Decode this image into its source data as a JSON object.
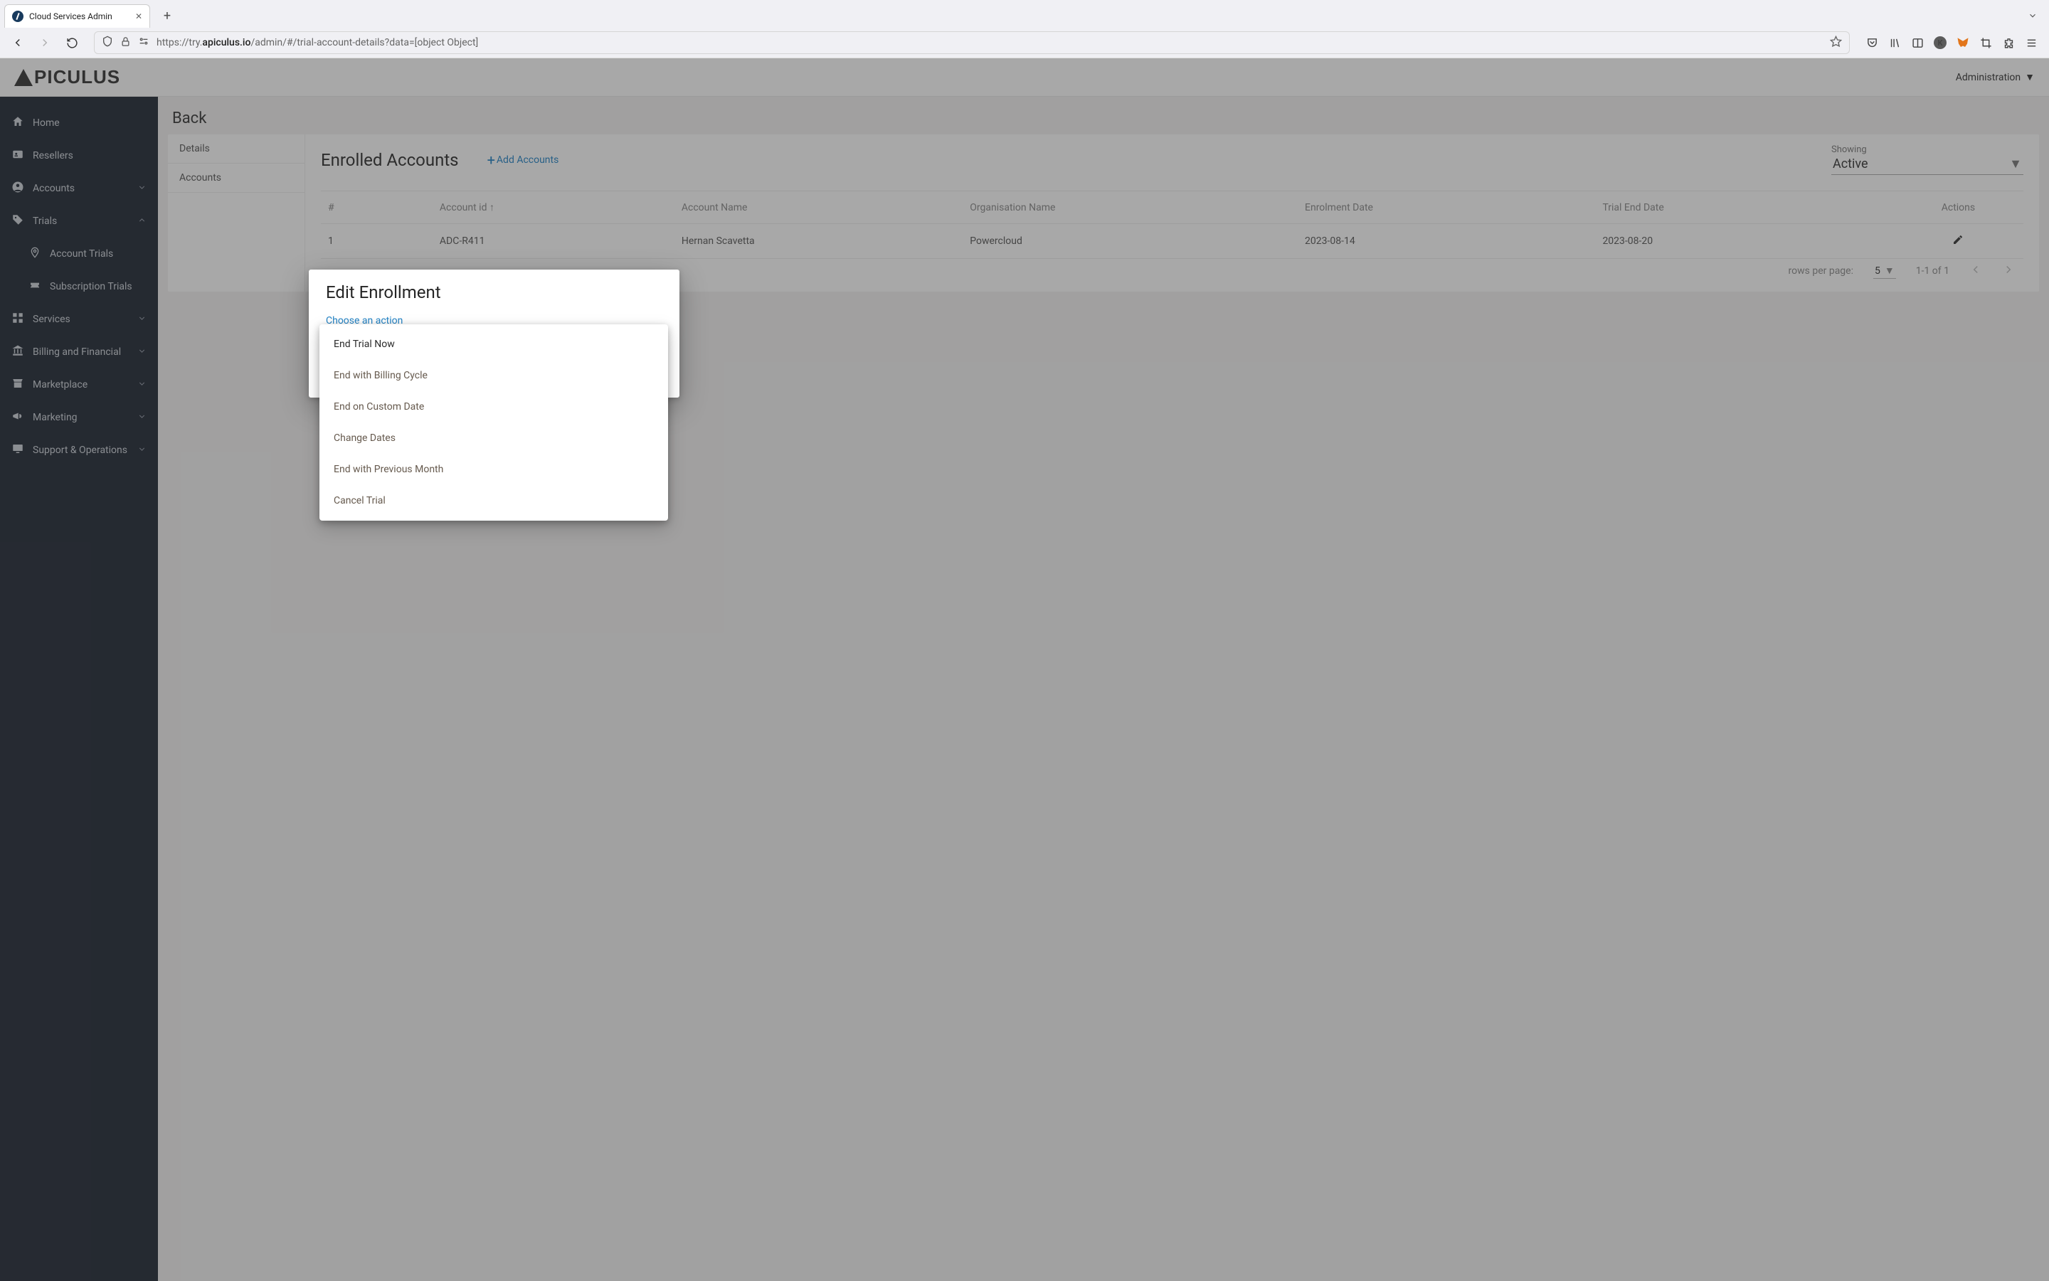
{
  "browser": {
    "tab_title": "Cloud Services Admin",
    "url_prefix": "https://try.",
    "url_bold": "apiculus.io",
    "url_suffix": "/admin/#/trial-account-details?data=[object Object]"
  },
  "header": {
    "logo_text": "PICULUS",
    "admin_label": "Administration"
  },
  "sidebar": {
    "items": [
      {
        "label": "Home",
        "icon": "home-icon",
        "expandable": false
      },
      {
        "label": "Resellers",
        "icon": "id-card-icon",
        "expandable": false
      },
      {
        "label": "Accounts",
        "icon": "person-circle-icon",
        "expandable": true,
        "expanded": false
      },
      {
        "label": "Trials",
        "icon": "tag-icon",
        "expandable": true,
        "expanded": true,
        "children": [
          {
            "label": "Account Trials",
            "icon": "marker-icon"
          },
          {
            "label": "Subscription Trials",
            "icon": "ticket-icon"
          }
        ]
      },
      {
        "label": "Services",
        "icon": "library-icon",
        "expandable": true,
        "expanded": false
      },
      {
        "label": "Billing and Financial",
        "icon": "bank-icon",
        "expandable": true,
        "expanded": false
      },
      {
        "label": "Marketplace",
        "icon": "store-icon",
        "expandable": true,
        "expanded": false
      },
      {
        "label": "Marketing",
        "icon": "megaphone-icon",
        "expandable": true,
        "expanded": false
      },
      {
        "label": "Support & Operations",
        "icon": "monitor-icon",
        "expandable": true,
        "expanded": false
      }
    ]
  },
  "page": {
    "back_label": "Back",
    "side_tabs": [
      "Details",
      "Accounts"
    ],
    "title": "Enrolled Accounts",
    "add_label": "Add Accounts",
    "showing_label": "Showing",
    "showing_value": "Active",
    "table": {
      "headers": [
        "#",
        "Account id",
        "Account Name",
        "Organisation Name",
        "Enrolment Date",
        "Trial End Date",
        "Actions"
      ],
      "rows": [
        {
          "num": "1",
          "id": "ADC-R411",
          "name": "Hernan Scavetta",
          "org": "Powercloud",
          "enrol": "2023-08-14",
          "end": "2023-08-20"
        }
      ]
    },
    "pager": {
      "rows_label": "rows per page:",
      "rows_value": "5",
      "range": "1-1 of 1"
    }
  },
  "modal": {
    "title": "Edit Enrollment",
    "field_label": "Choose an action",
    "options": [
      "End Trial Now",
      "End with Billing Cycle",
      "End on Custom Date",
      "Change Dates",
      "End with Previous Month",
      "Cancel Trial"
    ]
  }
}
